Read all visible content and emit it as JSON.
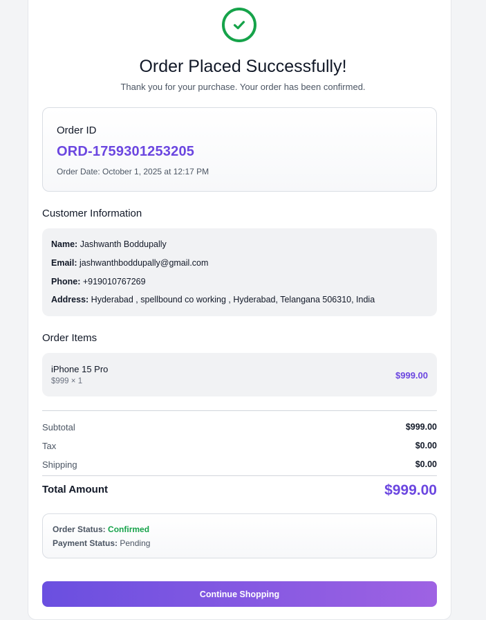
{
  "header": {
    "title": "Order Placed Successfully!",
    "subtitle": "Thank you for your purchase. Your order has been confirmed.",
    "success_icon": "check-circle-icon"
  },
  "order": {
    "label": "Order ID",
    "id": "ORD-1759301253205",
    "date": "Order Date: October 1, 2025 at 12:17 PM"
  },
  "customer": {
    "title": "Customer Information",
    "name_label": "Name:",
    "name": "Jashwanth Boddupally",
    "email_label": "Email:",
    "email": "jashwanthboddupally@gmail.com",
    "phone_label": "Phone:",
    "phone": "+919010767269",
    "address_label": "Address:",
    "address": "Hyderabad , spellbound co working , Hyderabad, Telangana 506310, India"
  },
  "items": {
    "title": "Order Items",
    "list": [
      {
        "name": "iPhone 15 Pro",
        "qty": "$999 × 1",
        "price": "$999.00"
      }
    ]
  },
  "summary": {
    "subtotal_label": "Subtotal",
    "subtotal": "$999.00",
    "tax_label": "Tax",
    "tax": "$0.00",
    "shipping_label": "Shipping",
    "shipping": "$0.00",
    "total_label": "Total Amount",
    "total": "$999.00"
  },
  "status": {
    "order_label": "Order Status:",
    "order_value": "Confirmed",
    "payment_label": "Payment Status:",
    "payment_value": "Pending"
  },
  "actions": {
    "continue_label": "Continue Shopping"
  },
  "colors": {
    "accent": "#6b46e0",
    "success": "#16a34a"
  }
}
